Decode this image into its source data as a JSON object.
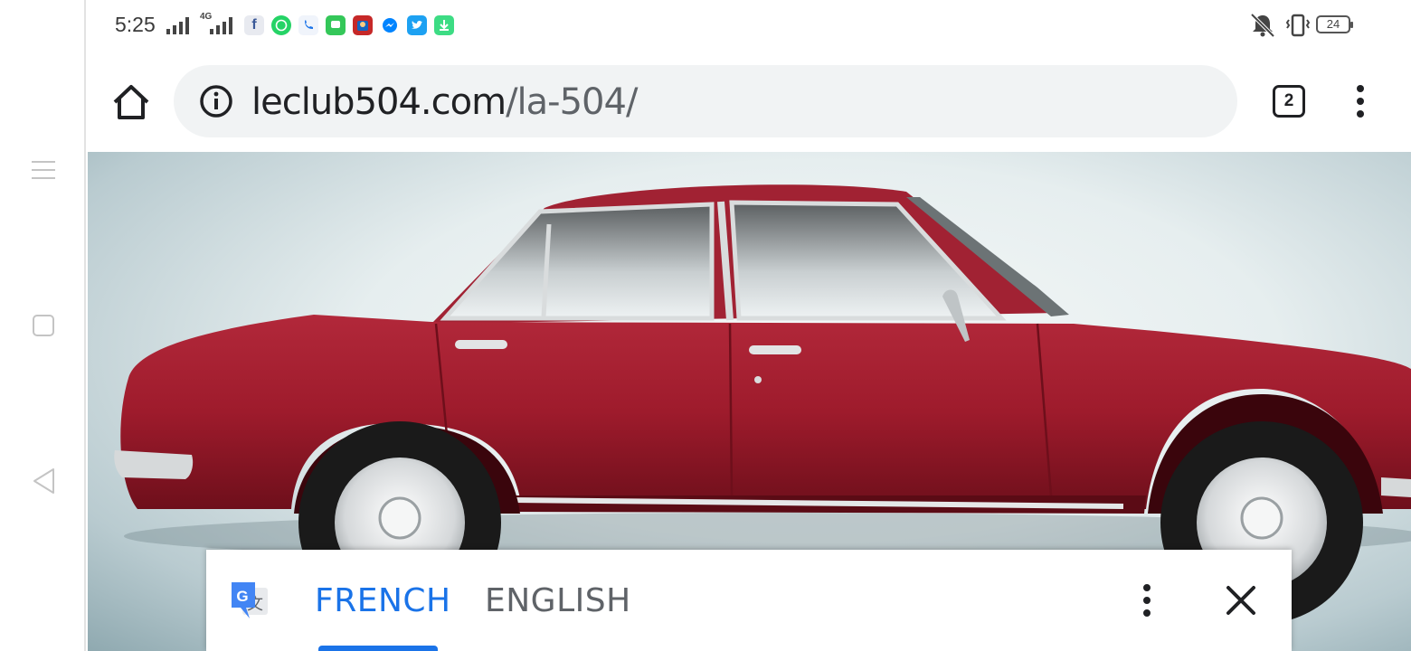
{
  "status_bar": {
    "time": "5:25",
    "network_label": "4G",
    "battery_level": "24",
    "notification_icons": [
      "facebook-icon",
      "whatsapp-icon",
      "phone-icon",
      "messages-icon",
      "game-icon",
      "messenger-icon",
      "twitter-icon",
      "download-icon"
    ]
  },
  "browser": {
    "url_domain": "leclub504.com",
    "url_path": "/la-504/",
    "tab_count": "2"
  },
  "translate_bar": {
    "source_language": "FRENCH",
    "target_language": "ENGLISH",
    "selected": "FRENCH"
  },
  "colors": {
    "accent": "#1a73e8",
    "car_red": "#9e1b2c"
  }
}
